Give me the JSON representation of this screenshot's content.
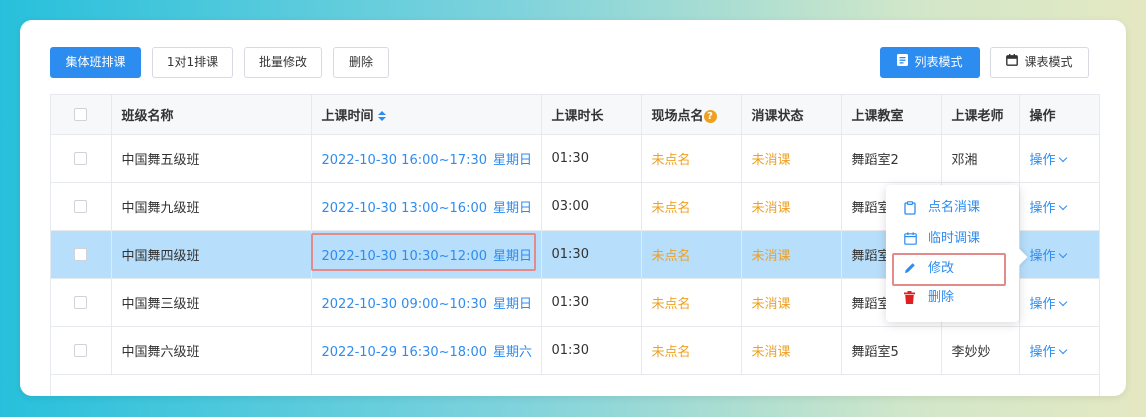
{
  "toolbar": {
    "group_schedule": "集体班排课",
    "one_on_one": "1对1排课",
    "batch_edit": "批量修改",
    "delete": "删除",
    "list_mode": "列表模式",
    "calendar_mode": "课表模式"
  },
  "table": {
    "headers": [
      "班级名称",
      "上课时间",
      "上课时长",
      "现场点名",
      "消课状态",
      "上课教室",
      "上课老师",
      "操作"
    ],
    "help_icon": "?",
    "rows": [
      {
        "class": "中国舞五级班",
        "time": "2022-10-30 16:00~17:30",
        "weekday": "星期日",
        "duration": "01:30",
        "rollcall": "未点名",
        "status": "未消课",
        "room": "舞蹈室2",
        "teacher": "邓湘",
        "op": "操作"
      },
      {
        "class": "中国舞九级班",
        "time": "2022-10-30 13:00~16:00",
        "weekday": "星期日",
        "duration": "03:00",
        "rollcall": "未点名",
        "status": "未消课",
        "room": "舞蹈室",
        "teacher": "",
        "op": "操作"
      },
      {
        "class": "中国舞四级班",
        "time": "2022-10-30 10:30~12:00",
        "weekday": "星期日",
        "duration": "01:30",
        "rollcall": "未点名",
        "status": "未消课",
        "room": "舞蹈室",
        "teacher": "",
        "op": "操作"
      },
      {
        "class": "中国舞三级班",
        "time": "2022-10-30 09:00~10:30",
        "weekday": "星期日",
        "duration": "01:30",
        "rollcall": "未点名",
        "status": "未消课",
        "room": "舞蹈室",
        "teacher": "",
        "op": "操作"
      },
      {
        "class": "中国舞六级班",
        "time": "2022-10-29 16:30~18:00",
        "weekday": "星期六",
        "duration": "01:30",
        "rollcall": "未点名",
        "status": "未消课",
        "room": "舞蹈室5",
        "teacher": "李妙妙",
        "op": "操作"
      }
    ]
  },
  "menu": {
    "rollcall": "点名消课",
    "reschedule": "临时调课",
    "edit": "修改",
    "delete": "删除"
  },
  "colors": {
    "primary": "#2d8cf0",
    "warning": "#f0a020",
    "highlight_row": "#b7defb",
    "delete_icon": "#e02020",
    "annotation": "#e38a8a"
  }
}
